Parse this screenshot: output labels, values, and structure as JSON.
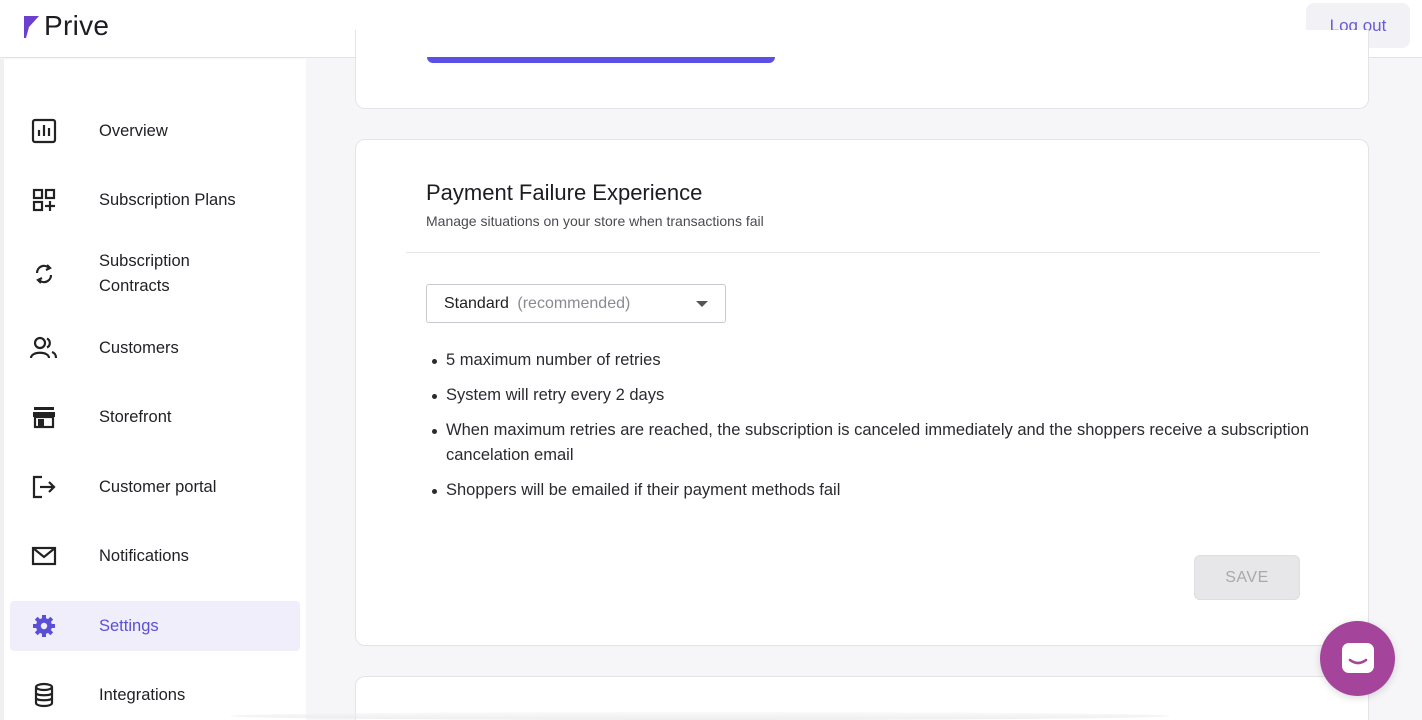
{
  "app": {
    "name": "Prive"
  },
  "header": {
    "logout_label": "Log out"
  },
  "sidebar": {
    "items": [
      {
        "label": "Overview",
        "icon": "chart-icon"
      },
      {
        "label": "Subscription Plans",
        "icon": "grid-add-icon"
      },
      {
        "label": "Subscription\nContracts",
        "icon": "sync-icon"
      },
      {
        "label": "Customers",
        "icon": "users-icon"
      },
      {
        "label": "Storefront",
        "icon": "store-icon"
      },
      {
        "label": "Customer portal",
        "icon": "logout-arrow-icon"
      },
      {
        "label": "Notifications",
        "icon": "mail-icon"
      },
      {
        "label": "Settings",
        "icon": "gear-icon",
        "active": true
      },
      {
        "label": "Integrations",
        "icon": "database-icon"
      }
    ]
  },
  "payment_failure": {
    "title": "Payment Failure Experience",
    "subtitle": "Manage situations on your store when transactions fail",
    "select_value": "Standard",
    "select_hint": "(recommended)",
    "bullets": [
      "5 maximum number of retries",
      "System will retry every 2 days",
      "When maximum retries are reached, the subscription is canceled immediately and the shoppers receive a subscription cancelation email",
      "Shoppers will be emailed if their payment methods fail"
    ],
    "save_label": "SAVE"
  },
  "colors": {
    "accent": "#5b4fd6",
    "active_bg": "#efeefa",
    "logo": "#6b3fd0",
    "chat": "#a4459b"
  }
}
